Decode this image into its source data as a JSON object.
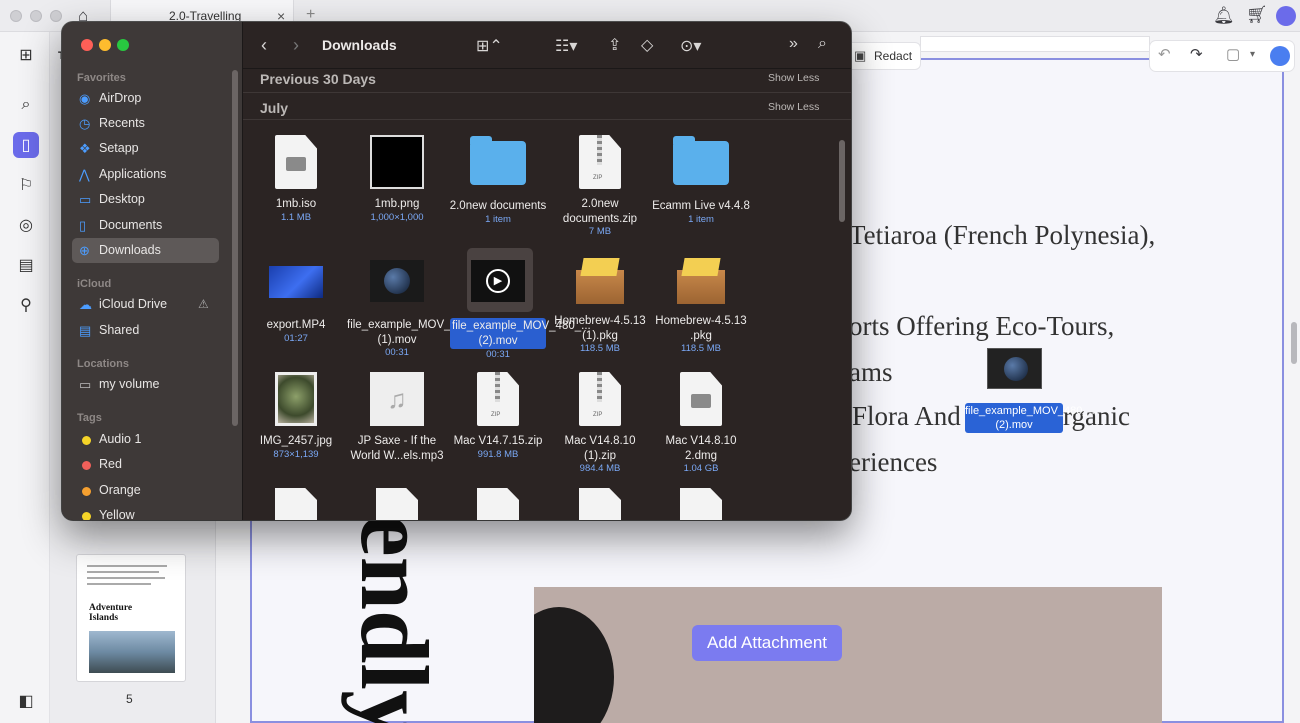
{
  "browser": {
    "tab_title": "2.0-Travelling",
    "tab_close": "×",
    "new_tab": "+"
  },
  "document": {
    "redact_label": "Redact",
    "lines": [
      "Tetiaroa (French Polynesia),",
      "orts Offering Eco-Tours,",
      "ams",
      "Flora And",
      "rganic",
      "eriences"
    ],
    "vertical_text": "endly",
    "add_attachment": "Add Attachment",
    "page_number": "5",
    "thumb_title": "Adventure Islands",
    "thumb_left_letter": "T"
  },
  "drag": {
    "label": "file_example_MOV_480_...(2).mov"
  },
  "finder": {
    "title": "Downloads",
    "sidebar": {
      "favorites_header": "Favorites",
      "favorites": [
        {
          "label": "AirDrop",
          "icon": "airdrop-icon"
        },
        {
          "label": "Recents",
          "icon": "clock-icon"
        },
        {
          "label": "Setapp",
          "icon": "setapp-icon"
        },
        {
          "label": "Applications",
          "icon": "applications-icon"
        },
        {
          "label": "Desktop",
          "icon": "desktop-icon"
        },
        {
          "label": "Documents",
          "icon": "document-icon"
        },
        {
          "label": "Downloads",
          "icon": "download-icon",
          "selected": true
        }
      ],
      "icloud_header": "iCloud",
      "icloud": [
        {
          "label": "iCloud Drive",
          "icon": "cloud-icon"
        },
        {
          "label": "Shared",
          "icon": "shared-folder-icon"
        }
      ],
      "locations_header": "Locations",
      "locations": [
        {
          "label": "my volume",
          "icon": "drive-icon"
        }
      ],
      "tags_header": "Tags",
      "tags": [
        {
          "label": "Audio 1",
          "color": "#f5d428"
        },
        {
          "label": "Red",
          "color": "#f0605a"
        },
        {
          "label": "Orange",
          "color": "#f5a030"
        },
        {
          "label": "Yellow",
          "color": "#f5d428"
        }
      ]
    },
    "groups": {
      "prev30": "Previous 30 Days",
      "july": "July",
      "show_less": "Show Less"
    },
    "items": [
      {
        "name": "1mb.iso",
        "sub": "1.1 MB",
        "kind": "disk"
      },
      {
        "name": "1mb.png",
        "sub": "1,000×1,000",
        "kind": "black"
      },
      {
        "name": "2.0new documents",
        "sub": "1 item",
        "kind": "folder"
      },
      {
        "name": "2.0new documents.zip",
        "sub": "7 MB",
        "kind": "zip"
      },
      {
        "name": "Ecamm Live v4.4.8",
        "sub": "1 item",
        "kind": "folder"
      },
      {
        "name": "export.MP4",
        "sub": "01:27",
        "kind": "bluevideo"
      },
      {
        "name": "file_example_MOV_480_...(1).mov",
        "sub": "00:31",
        "kind": "earth"
      },
      {
        "name": "file_example_MOV_480_...(2).mov",
        "sub": "00:31",
        "kind": "play",
        "selected": true
      },
      {
        "name": "Homebrew-4.5.13 (1).pkg",
        "sub": "118.5 MB",
        "kind": "box"
      },
      {
        "name": "Homebrew-4.5.13 .pkg",
        "sub": "118.5 MB",
        "kind": "box"
      },
      {
        "name": "IMG_2457.jpg",
        "sub": "873×1,139",
        "kind": "photo"
      },
      {
        "name": "JP Saxe - If the World W...els.mp3",
        "sub": "",
        "kind": "music"
      },
      {
        "name": "Mac V14.7.15.zip",
        "sub": "991.8 MB",
        "kind": "zip"
      },
      {
        "name": "Mac V14.8.10 (1).zip",
        "sub": "984.4 MB",
        "kind": "zip"
      },
      {
        "name": "Mac V14.8.10 2.dmg",
        "sub": "1.04 GB",
        "kind": "disk"
      }
    ],
    "colors": {
      "selection": "#2a5fd0",
      "accent": "#4c9dff"
    }
  },
  "colors": {
    "page_border": "#8a8fe0",
    "button": "#7b7bf0"
  }
}
